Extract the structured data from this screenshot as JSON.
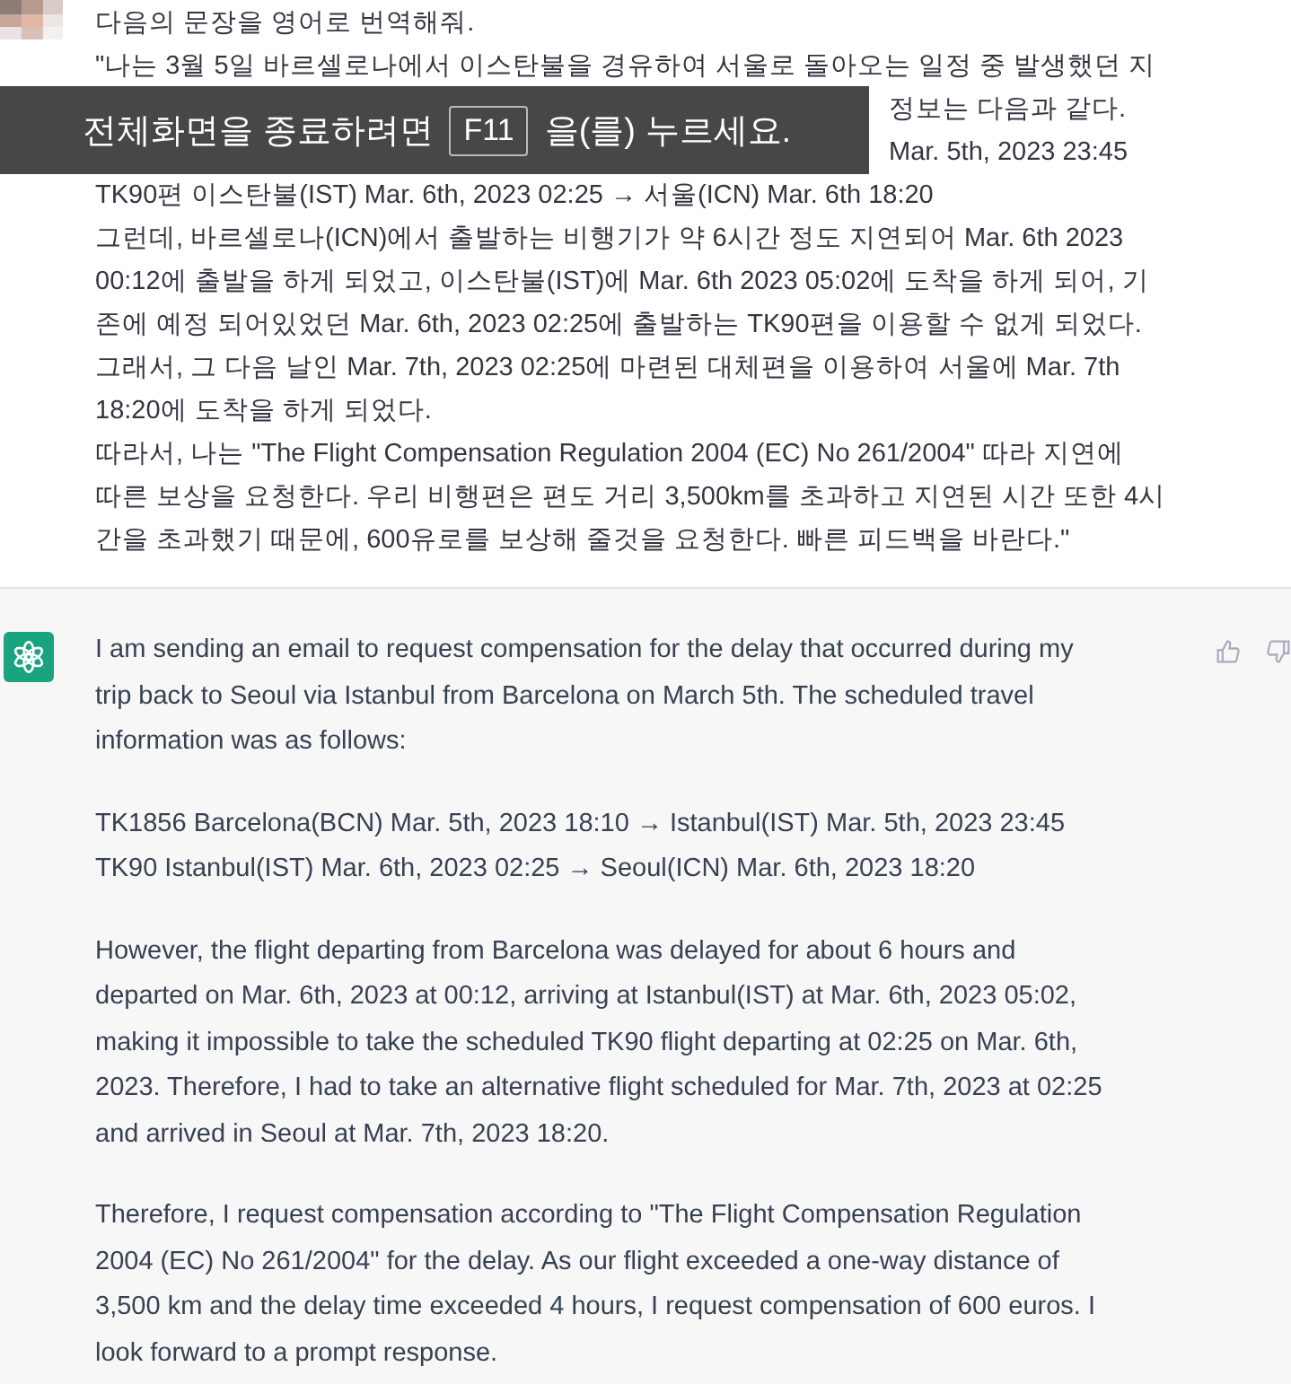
{
  "user_message": {
    "lines": [
      "다음의 문장을 영어로 번역해줘.",
      "\"나는 3월 5일 바르셀로나에서 이스탄불을 경유하여 서울로 돌아오는 일정 중 발생했던 지",
      {
        "text": "정보는 다음과 같다.",
        "partly_covered": true
      },
      {
        "text": "Mar. 5th, 2023 23:45",
        "partly_covered": true
      },
      "TK90편 이스탄불(IST) Mar. 6th, 2023 02:25 → 서울(ICN) Mar. 6th 18:20",
      "그런데, 바르셀로나(ICN)에서 출발하는 비행기가 약 6시간 정도 지연되어 Mar. 6th 2023",
      "00:12에 출발을 하게 되었고, 이스탄불(IST)에 Mar. 6th 2023 05:02에 도착을 하게 되어, 기",
      "존에 예정 되어있었던 Mar. 6th, 2023 02:25에 출발하는 TK90편을 이용할 수 없게 되었다.",
      "그래서, 그 다음 날인 Mar. 7th, 2023 02:25에 마련된 대체편을 이용하여 서울에 Mar. 7th",
      "18:20에 도착을 하게 되었다.",
      "따라서, 나는 \"The Flight Compensation Regulation 2004 (EC) No 261/2004\" 따라 지연에",
      "따른 보상을 요청한다. 우리 비행편은 편도 거리 3,500km를 초과하고 지연된 시간 또한 4시",
      "간을 초과했기 때문에, 600유로를 보상해 줄것을 요청한다. 빠른 피드백을 바란다.\""
    ]
  },
  "assistant_message": {
    "paragraphs": [
      [
        "I am sending an email to request compensation for the delay that occurred during my",
        "trip back to Seoul via Istanbul from Barcelona on March 5th. The scheduled travel",
        "information was as follows:"
      ],
      [
        "TK1856 Barcelona(BCN) Mar. 5th, 2023 18:10 → Istanbul(IST) Mar. 5th, 2023 23:45",
        "TK90 Istanbul(IST) Mar. 6th, 2023 02:25 → Seoul(ICN) Mar. 6th, 2023 18:20"
      ],
      [
        "However, the flight departing from Barcelona was delayed for about 6 hours and",
        "departed on Mar. 6th, 2023 at 00:12, arriving at Istanbul(IST) at Mar. 6th, 2023 05:02,",
        "making it impossible to take the scheduled TK90 flight departing at 02:25 on Mar. 6th,",
        "2023. Therefore, I had to take an alternative flight scheduled for Mar. 7th, 2023 at 02:25",
        "and arrived in Seoul at Mar. 7th, 2023 18:20."
      ],
      [
        "Therefore, I request compensation according to \"The Flight Compensation Regulation",
        "2004 (EC) No 261/2004\" for the delay. As our flight exceeded a one-way distance of",
        "3,500 km and the delay time exceeded 4 hours, I request compensation of 600 euros. I",
        "look forward to a prompt response."
      ]
    ]
  },
  "fullscreen_notice": {
    "before": "전체화면을 종료하려면",
    "key": "F11",
    "after": "을(를) 누르세요."
  }
}
